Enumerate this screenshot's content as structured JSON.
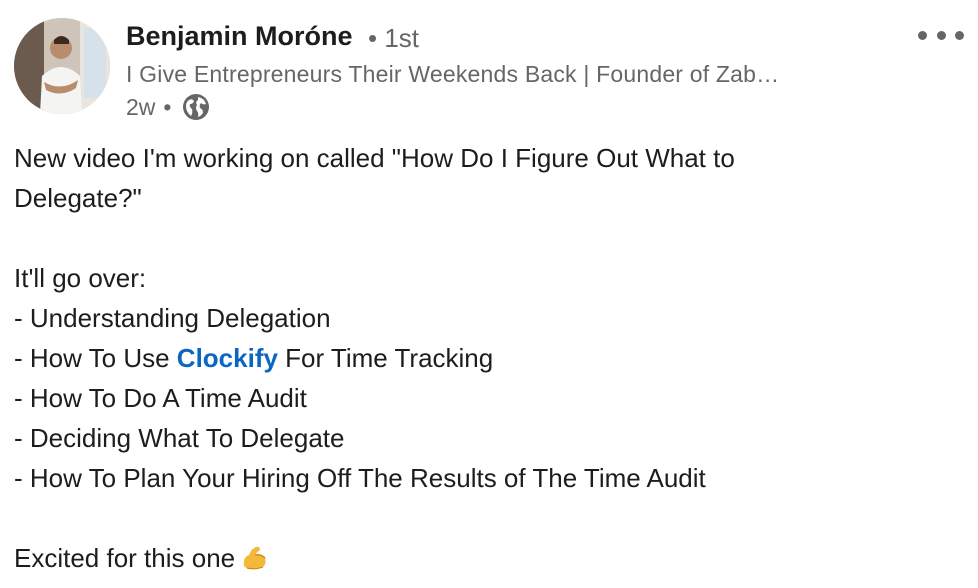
{
  "author": {
    "name": "Benjamin Moróne",
    "degree": "• 1st",
    "headline": "I Give Entrepreneurs Their Weekends Back | Founder of Zab…",
    "time_ago": "2w",
    "separator": "•",
    "visibility_icon": "globe-icon",
    "avatar_icon": "profile-photo"
  },
  "menu": {
    "icon": "more-options-icon"
  },
  "post": {
    "line1": "New video I'm working on called \"How Do I Figure Out What to",
    "line2": "Delegate?\"",
    "intro": "It'll go over:",
    "items": [
      "- Understanding Delegation",
      "- How To Use ",
      "- How To Do A Time Audit",
      "- Deciding What To Delegate",
      "- How To Plan Your Hiring Off The Results of The Time Audit"
    ],
    "item2_link": "Clockify",
    "item2_suffix": " For Time Tracking",
    "closing": "Excited for this one",
    "closing_emoji": "flexed-biceps-emoji"
  },
  "colors": {
    "link": "#0a66c2",
    "secondary_text": "#666666",
    "primary_text": "#1d1d1d"
  }
}
